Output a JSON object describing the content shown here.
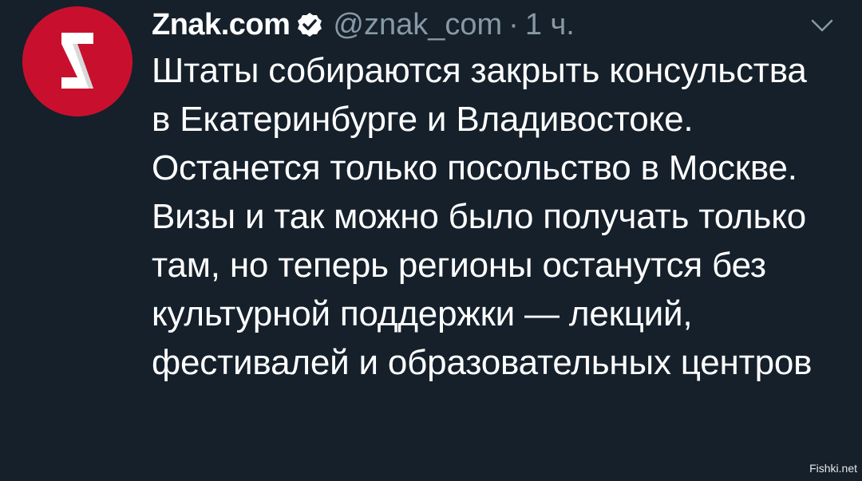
{
  "tweet": {
    "display_name": "Znak.com",
    "handle": "@znak_com",
    "separator": "·",
    "time": "1 ч.",
    "verified": true,
    "text": "Штаты собираются закрыть консульства в Екатеринбурге и Владивостоке. Останется только посольство в Москве. Визы и так можно было получать только там, но теперь регионы останутся без культурной поддержки — лекций, фестивалей и образовательных центров",
    "avatar_letter": "Z"
  },
  "watermark": "Fishki.net",
  "colors": {
    "background": "#15202b",
    "avatar_bg": "#c8102e",
    "secondary_text": "#8899a6",
    "primary_text": "#ffffff"
  },
  "icons": {
    "verified": "verified-badge-icon",
    "more": "chevron-down-icon"
  }
}
